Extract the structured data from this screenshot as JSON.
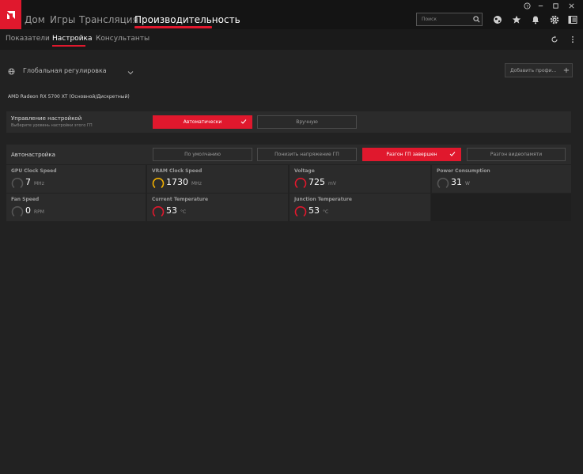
{
  "nav": {
    "items": [
      "Дом",
      "Игры",
      "Трансляция",
      "Производительность"
    ],
    "active": "Производительность"
  },
  "search": {
    "placeholder": "Поиск"
  },
  "top_icons": [
    "help-icon",
    "minimize-icon",
    "maximize-icon",
    "close-icon",
    "globe-icon",
    "star-icon",
    "bell-icon",
    "gear-icon",
    "layout-icon"
  ],
  "subnav": {
    "items": [
      "Показатели",
      "Настройка",
      "Консультанты"
    ],
    "active": "Настройка"
  },
  "profile": {
    "label": "Глобальная регулировка",
    "add_label": "Добавить профи..."
  },
  "gpu_name": "AMD Radeon RX 5700 XT (Основной/Дискретный)",
  "tuning_control": {
    "label": "Управление настройкой",
    "sublabel": "Выберите уровень настройки этого ГП",
    "options": [
      "Автоматически",
      "Вручную"
    ],
    "selected": "Автоматически"
  },
  "auto_tuning": {
    "label": "Автонастройка",
    "options": [
      "По умолчанию",
      "Понизить напряжение ГП",
      "Разгон ГП завершен",
      "Разгон видеопамяти"
    ],
    "selected": "Разгон ГП завершен"
  },
  "metrics": [
    {
      "label": "GPU Clock Speed",
      "value": "7",
      "unit": "MHz",
      "gauge_color": "#555555"
    },
    {
      "label": "VRAM Clock Speed",
      "value": "1730",
      "unit": "MHz",
      "gauge_color": "#f2b000"
    },
    {
      "label": "Voltage",
      "value": "725",
      "unit": "mV",
      "gauge_color": "#e0182d"
    },
    {
      "label": "Power Consumption",
      "value": "31",
      "unit": "W",
      "gauge_color": "#555555"
    },
    {
      "label": "Fan Speed",
      "value": "0",
      "unit": "RPM",
      "gauge_color": "#555555"
    },
    {
      "label": "Current Temperature",
      "value": "53",
      "unit": "°C",
      "gauge_color": "#e0182d"
    },
    {
      "label": "Junction Temperature",
      "value": "53",
      "unit": "°C",
      "gauge_color": "#e0182d"
    }
  ],
  "colors": {
    "accent": "#e0182d",
    "background": "#222222",
    "topbar": "#141414",
    "panel": "#2b2b2b"
  }
}
